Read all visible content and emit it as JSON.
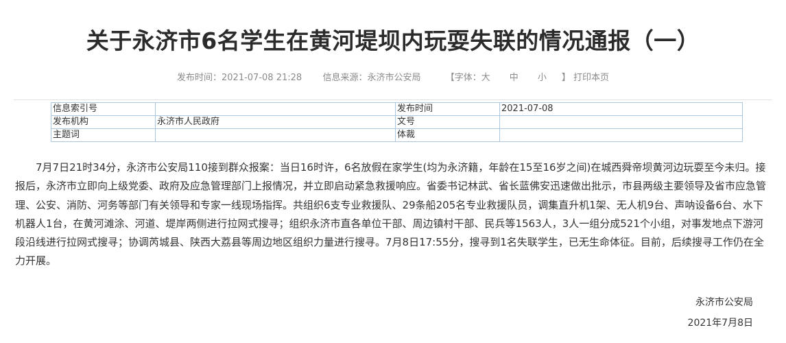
{
  "title": "关于永济市6名学生在黄河堤坝内玩耍失联的情况通报（一）",
  "meta": {
    "publish_label": "发布时间：",
    "publish_value": "2021-07-08 21:28",
    "source_label": "信息来源：",
    "source_value": "永济市公安局",
    "font_open": "【字体：",
    "font_large": "大",
    "font_medium": "中",
    "font_small": "小",
    "font_close": "】",
    "print": "打印本页"
  },
  "info_table": {
    "rows": [
      {
        "label1": "信息索引号",
        "value1": "",
        "label2": "发布时间",
        "value2": "2021-07-08"
      },
      {
        "label1": "发布机构",
        "value1": "永济市人民政府",
        "label2": "文号",
        "value2": ""
      },
      {
        "label1": "主题词",
        "value1": "",
        "label2": "体裁",
        "value2": ""
      }
    ]
  },
  "body": "7月7日21时34分，永济市公安局110接到群众报案：当日16时许，6名放假在家学生(均为永济籍，年龄在15至16岁之间)在城西舜帝坝黄河边玩耍至今未归。接报后，永济市立即向上级党委、政府及应急管理部门上报情况，并立即启动紧急救援响应。省委书记林武、省长蓝佛安迅速做出批示，市县两级主要领导及省市应急管理、公安、消防、河务等部门有关领导和专家一线现场指挥。共组织6支专业救援队、29条船205名专业救援队员，调集直升机1架、无人机9台、声呐设备6台、水下机器人1台，在黄河滩涂、河道、堤岸两侧进行拉网式搜寻；组织永济市直各单位干部、周边镇村干部、民兵等1563人，3人一组分成521个小组，对事发地点下游河段沿线进行拉网式搜寻；协调芮城县、陕西大荔县等周边地区组织力量进行搜寻。7月8日17:55分，搜寻到1名失联学生，已无生命体征。目前，后续搜寻工作仍在全力开展。",
  "signature": {
    "org": "永济市公安局",
    "date": "2021年7月8日"
  }
}
